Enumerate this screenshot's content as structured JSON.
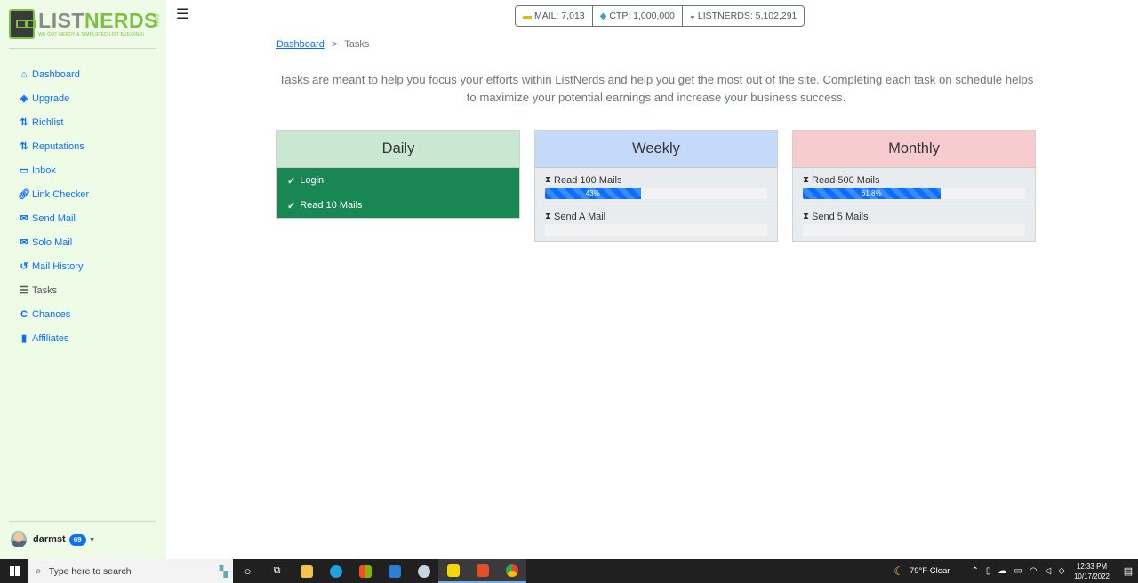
{
  "brand": {
    "name_part1": "LIST",
    "name_part2": "NERDS",
    "tagline": "WE GOT NERDY & SIMPLIFIED LIST BUILDING!",
    "suffix": ".COM"
  },
  "sidebar": {
    "items": [
      {
        "label": "Dashboard",
        "icon": "home-icon"
      },
      {
        "label": "Upgrade",
        "icon": "layers-icon"
      },
      {
        "label": "Richlist",
        "icon": "sort-icon"
      },
      {
        "label": "Reputations",
        "icon": "sort-icon"
      },
      {
        "label": "Inbox",
        "icon": "inbox-icon"
      },
      {
        "label": "Link Checker",
        "icon": "link-icon"
      },
      {
        "label": "Send Mail",
        "icon": "envelope-icon"
      },
      {
        "label": "Solo Mail",
        "icon": "envelope-open-icon"
      },
      {
        "label": "Mail History",
        "icon": "history-icon"
      },
      {
        "label": "Tasks",
        "icon": "list-icon"
      },
      {
        "label": "Chances",
        "icon": "c-icon"
      },
      {
        "label": "Affiliates",
        "icon": "signal-icon"
      }
    ],
    "user": {
      "name": "darmst",
      "badge": "69"
    }
  },
  "header": {
    "stats": [
      {
        "label": "MAIL: 7,013",
        "icon": "coins-icon"
      },
      {
        "label": "CTP: 1,000,000",
        "icon": "gem-icon"
      },
      {
        "label": "LISTNERDS: 5,102,291",
        "icon": "nerd-icon"
      }
    ]
  },
  "breadcrumb": {
    "home": "Dashboard",
    "separator": ">",
    "current": "Tasks"
  },
  "intro": "Tasks are meant to help you focus your efforts within ListNerds and help you get the most out of the site. Completing each task on schedule helps to maximize your potential earnings and increase your business success.",
  "cards": {
    "daily": {
      "title": "Daily",
      "tasks": [
        {
          "label": "Login",
          "done": true
        },
        {
          "label": "Read 10 Mails",
          "done": true
        }
      ]
    },
    "weekly": {
      "title": "Weekly",
      "tasks": [
        {
          "label": "Read 100 Mails",
          "progress": 43,
          "progress_text": "43%"
        },
        {
          "label": "Send A Mail",
          "progress": 0,
          "progress_text": ""
        }
      ]
    },
    "monthly": {
      "title": "Monthly",
      "tasks": [
        {
          "label": "Read 500 Mails",
          "progress": 61.8,
          "progress_text": "61.8%"
        },
        {
          "label": "Send 5 Mails",
          "progress": 0,
          "progress_text": ""
        }
      ]
    }
  },
  "taskbar": {
    "search_placeholder": "Type here to search",
    "weather": "79°F  Clear",
    "time": "12:33 PM",
    "date": "10/17/2022",
    "apps": [
      "task-view",
      "file-explorer",
      "edge",
      "store",
      "mail",
      "app-bird",
      "sticky-notes",
      "brave",
      "chrome"
    ]
  },
  "colors": {
    "accent": "#0d6efd",
    "daily_head": "#c9e7d1",
    "weekly_head": "#c4daf8",
    "monthly_head": "#f6cccf",
    "done_row": "#198754",
    "brand_green": "#7cc142"
  }
}
